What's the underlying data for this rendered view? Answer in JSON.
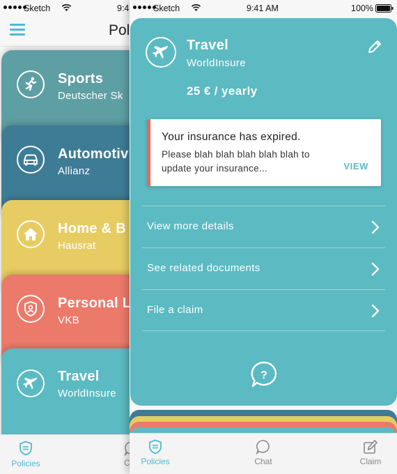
{
  "back_screen": {
    "status": {
      "carrier": "Sketch",
      "time": "9:4"
    },
    "nav_title": "Polic",
    "cards": [
      {
        "title": "Sports",
        "subtitle": "Deutscher Sk",
        "icon": "runner-icon",
        "color": "#5e9fa3"
      },
      {
        "title": "Automotiv",
        "subtitle": "Allianz",
        "icon": "car-icon",
        "color": "#3e7c96"
      },
      {
        "title": "Home & B",
        "subtitle": "Hausrat",
        "icon": "house-icon",
        "color": "#e7cc63"
      },
      {
        "title": "Personal L",
        "subtitle": "VKB",
        "icon": "person-shield-icon",
        "color": "#ec7a6b"
      },
      {
        "title": "Travel",
        "subtitle": "WorldInsure",
        "icon": "airplane-icon",
        "color": "#5bbac2"
      }
    ],
    "tabbar": {
      "policies": "Policies",
      "chat": "C"
    }
  },
  "front_screen": {
    "status": {
      "carrier": "Sketch",
      "time": "9:41 AM",
      "battery": "100%"
    },
    "detail": {
      "title": "Travel",
      "subtitle": "WorldInsure",
      "price": "25 € / yearly",
      "icon": "airplane-icon",
      "color": "#5bbac2"
    },
    "alert": {
      "title": "Your insurance has expired.",
      "body": "Please blah blah blah blah blah to update your insurance...",
      "action": "VIEW",
      "accent": "#e8685c"
    },
    "options": [
      "View more details",
      "See related documents",
      "File a claim"
    ],
    "stack_colors": [
      "#3e7c96",
      "#e7cc63",
      "#ec7a6b",
      "#5bbac2"
    ],
    "tabbar": {
      "policies": "Policies",
      "chat": "Chat",
      "claim": "Claim"
    },
    "accent": "#4dbad1"
  }
}
